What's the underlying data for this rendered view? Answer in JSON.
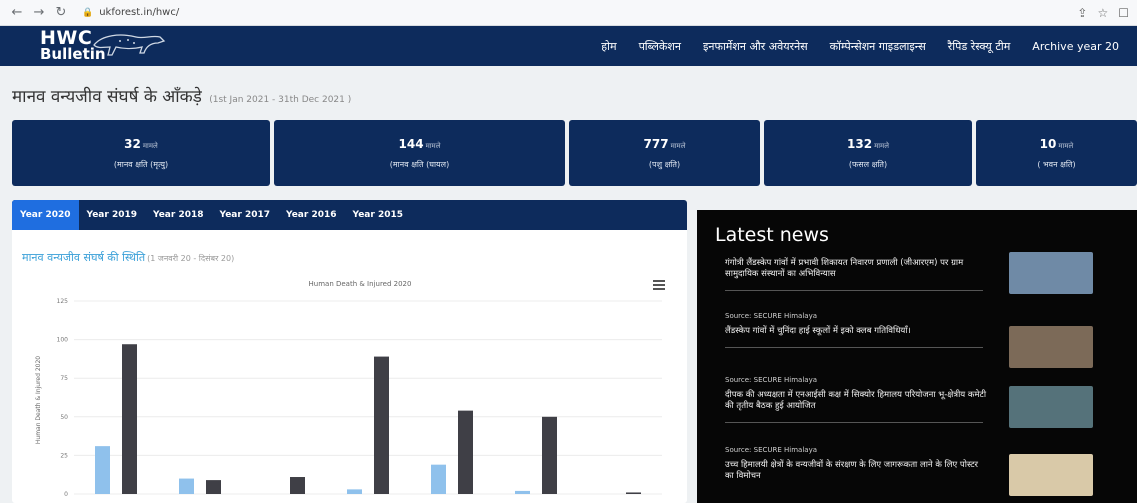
{
  "browser": {
    "url": "ukforest.in/hwc/"
  },
  "header": {
    "logo_line1": "HWC",
    "logo_line2": "Bulletin",
    "menu": [
      {
        "label": "होम"
      },
      {
        "label": "पब्लिकेशन"
      },
      {
        "label": "इनफार्मेशन और अवेयरनेस"
      },
      {
        "label": "कॉम्पेन्सेशन गाइडलाइन्स"
      },
      {
        "label": "रैपिड रेस्क्यू टीम"
      },
      {
        "label": "Archive year 20"
      }
    ]
  },
  "section": {
    "title": "मानव वन्यजीव संघर्ष के आँकड़े",
    "range": "(1st Jan 2021 - 31th Dec 2021 )"
  },
  "stats": [
    {
      "value": "32",
      "unit": "मामले",
      "label": "(मानव क्षति (मृत्यु)"
    },
    {
      "value": "144",
      "unit": "मामले",
      "label": "(मानव क्षति (घायल)"
    },
    {
      "value": "777",
      "unit": "मामले",
      "label": "(पशु क्षति)"
    },
    {
      "value": "132",
      "unit": "मामले",
      "label": "(फसल क्षति)"
    },
    {
      "value": "10",
      "unit": "मामले",
      "label": "( भवन क्षति)"
    }
  ],
  "chart_panel": {
    "tabs": [
      {
        "label": "Year 2020",
        "active": true
      },
      {
        "label": "Year 2019",
        "active": false
      },
      {
        "label": "Year 2018",
        "active": false
      },
      {
        "label": "Year 2017",
        "active": false
      },
      {
        "label": "Year 2016",
        "active": false
      },
      {
        "label": "Year 2015",
        "active": false
      }
    ],
    "heading": "मानव वन्यजीव संघर्ष की स्थिति",
    "heading_sub": "(1 जनवरी 20 - दिसंबर 20)",
    "menu_icon": "hamburger-icon"
  },
  "chart_data": {
    "type": "bar",
    "title": "Human Death & Injured 2020",
    "xlabel": "",
    "ylabel": "Human Death & Injured 2020",
    "ylim": [
      0,
      125
    ],
    "yticks": [
      "0",
      "25",
      "50",
      "75",
      "100",
      "125"
    ],
    "categories": [
      "",
      "",
      "",
      "",
      "",
      "",
      ""
    ],
    "series": [
      {
        "values": [
          31,
          10,
          0,
          3,
          19,
          2,
          0
        ],
        "color": "#8fc1ec"
      },
      {
        "values": [
          97,
          9,
          11,
          89,
          54,
          50,
          1
        ],
        "color": "#3f3f46"
      }
    ]
  },
  "news": {
    "heading": "Latest news",
    "items": [
      {
        "source": "",
        "title": "गंगोत्री लैंडस्केप गांवों में प्रभावी शिकायत निवारण प्रणाली (जीआरएम) पर ग्राम सामुदायिक संस्थानों का अभिविन्यास",
        "thumb_color": "#6f8aa6"
      },
      {
        "source": "Source: SECURE Himalaya",
        "title": "लैंडस्केप गांवों में चुनिंदा हाई स्कूलों में इको क्लब गतिविधियाँ।",
        "thumb_color": "#7c6a58"
      },
      {
        "source": "Source: SECURE Himalaya",
        "title": "दीपक की अध्यक्षता में एनआईसी कक्ष में सिक्योर हिमालय परियोजना भू-क्षेत्रीय कमेटी की तृतीय बैठक हुई आयोजित",
        "thumb_color": "#55727a"
      },
      {
        "source": "Source: SECURE Himalaya",
        "title": "उच्च हिमालयी क्षेत्रों के वन्यजीवों के संरक्षण के लिए जागरूकता लाने के लिए पोस्टर का विमोचन",
        "thumb_color": "#d9c9a8"
      }
    ]
  }
}
